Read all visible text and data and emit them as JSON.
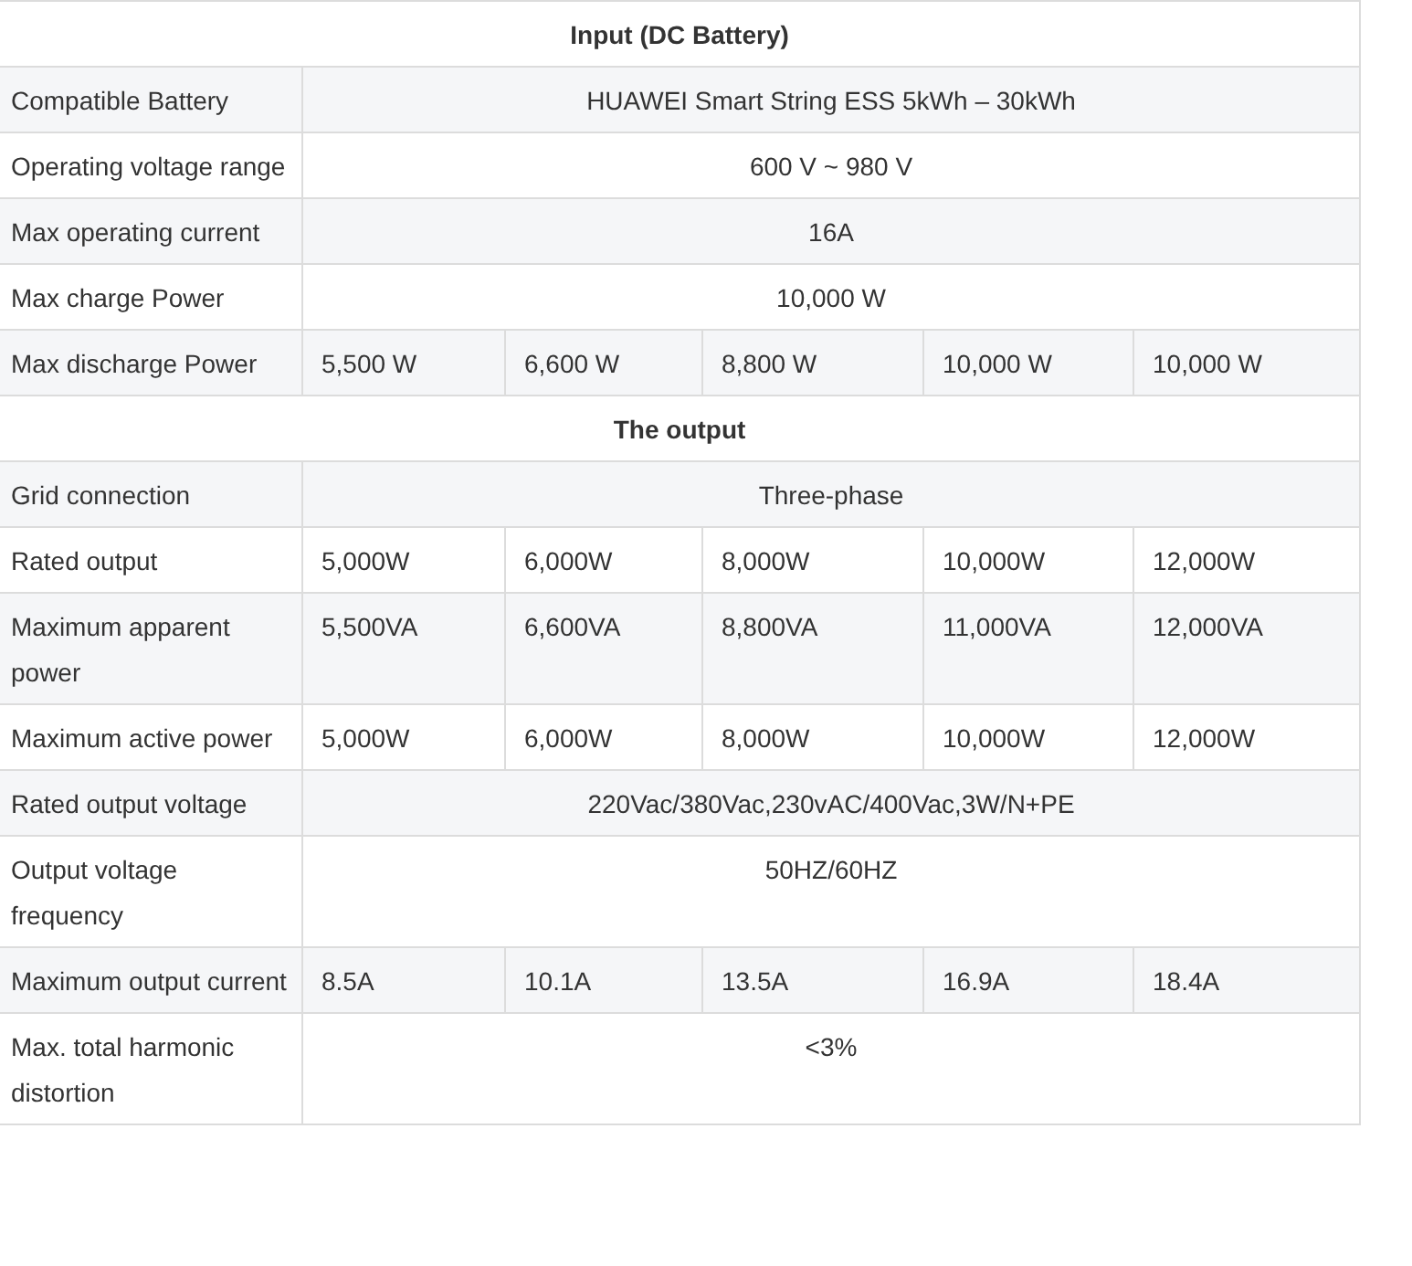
{
  "rows": [
    {
      "kind": "section",
      "title": "Input (DC Battery)"
    },
    {
      "kind": "merged",
      "label": "Compatible Battery",
      "value": "HUAWEI Smart String ESS 5kWh – 30kWh"
    },
    {
      "kind": "merged",
      "label": "Operating voltage range",
      "value": "600 V ~ 980 V"
    },
    {
      "kind": "merged",
      "label": "Max operating current",
      "value": "16A"
    },
    {
      "kind": "merged",
      "label": "Max charge Power",
      "value": "10,000 W"
    },
    {
      "kind": "split",
      "label": "Max discharge Power",
      "values": [
        "5,500 W",
        "6,600 W",
        "8,800 W",
        "10,000 W",
        "10,000 W"
      ]
    },
    {
      "kind": "section",
      "title": "The output"
    },
    {
      "kind": "merged",
      "label": "Grid connection",
      "value": "Three-phase"
    },
    {
      "kind": "split",
      "label": "Rated output",
      "values": [
        "5,000W",
        "6,000W",
        "8,000W",
        "10,000W",
        "12,000W"
      ]
    },
    {
      "kind": "split",
      "label": "Maximum apparent power",
      "values": [
        "5,500VA",
        "6,600VA",
        "8,800VA",
        "11,000VA",
        "12,000VA"
      ]
    },
    {
      "kind": "split",
      "label": "Maximum active power",
      "values": [
        "5,000W",
        "6,000W",
        "8,000W",
        "10,000W",
        "12,000W"
      ]
    },
    {
      "kind": "merged",
      "label": "Rated output voltage",
      "value": "220Vac/380Vac,230vAC/400Vac,3W/N+PE"
    },
    {
      "kind": "merged",
      "label": "Output voltage frequency",
      "value": "50HZ/60HZ"
    },
    {
      "kind": "split",
      "label": "Maximum output current",
      "values": [
        "8.5A",
        "10.1A",
        "13.5A",
        "16.9A",
        "18.4A"
      ]
    },
    {
      "kind": "merged",
      "label": "Max. total harmonic distortion",
      "value": "<3%"
    }
  ]
}
